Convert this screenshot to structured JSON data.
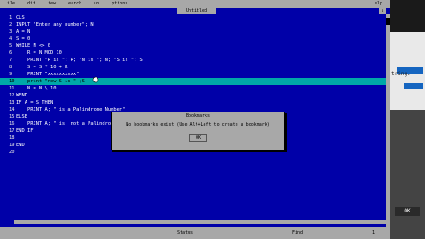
{
  "menu": [
    "ile",
    "dit",
    "iew",
    "earch",
    "un",
    "ptions"
  ],
  "menu_help": "elp",
  "window_title": "Untitled",
  "updown": "↕",
  "lines": [
    {
      "n": "1",
      "code": "CLS"
    },
    {
      "n": "2",
      "code": "INPUT \"Enter any number\"; N"
    },
    {
      "n": "3",
      "code": "A = N"
    },
    {
      "n": "4",
      "code": "S = 0"
    },
    {
      "n": "5",
      "code": "WHILE N <> 0"
    },
    {
      "n": "6",
      "code": "    R = N MOD 10"
    },
    {
      "n": "7",
      "code": "    PRINT \"R is \"; R; \"N is \"; N; \"S is \"; S"
    },
    {
      "n": "8",
      "code": "    S = S * 10 + R"
    },
    {
      "n": "9",
      "code": "    PRINT \"xxxxxxxxxx\""
    },
    {
      "n": "10",
      "code": "    print \"new S is \" ;S",
      "hl": true
    },
    {
      "n": "11",
      "code": "    N = N \\ 10"
    },
    {
      "n": "12",
      "code": "WEND"
    },
    {
      "n": "13",
      "code": "IF A = S THEN"
    },
    {
      "n": "14",
      "code": "    PRINT A; \" is a Palindrome Number\""
    },
    {
      "n": "15",
      "code": "ELSE"
    },
    {
      "n": "16",
      "code": "    PRINT A; \" is  not a Palindrome Number\""
    },
    {
      "n": "17",
      "code": "END IF"
    },
    {
      "n": "18",
      "code": ""
    },
    {
      "n": "19",
      "code": "END"
    },
    {
      "n": "20",
      "code": ""
    }
  ],
  "dialog": {
    "title": "Bookmarks",
    "message": "No bookmarks exist (Use Alt+Left to create a bookmark)",
    "ok": "OK"
  },
  "status": {
    "label": "Status",
    "position": "Find",
    "mode": "1"
  },
  "side": {
    "text": "tring.",
    "ok": "OK"
  }
}
